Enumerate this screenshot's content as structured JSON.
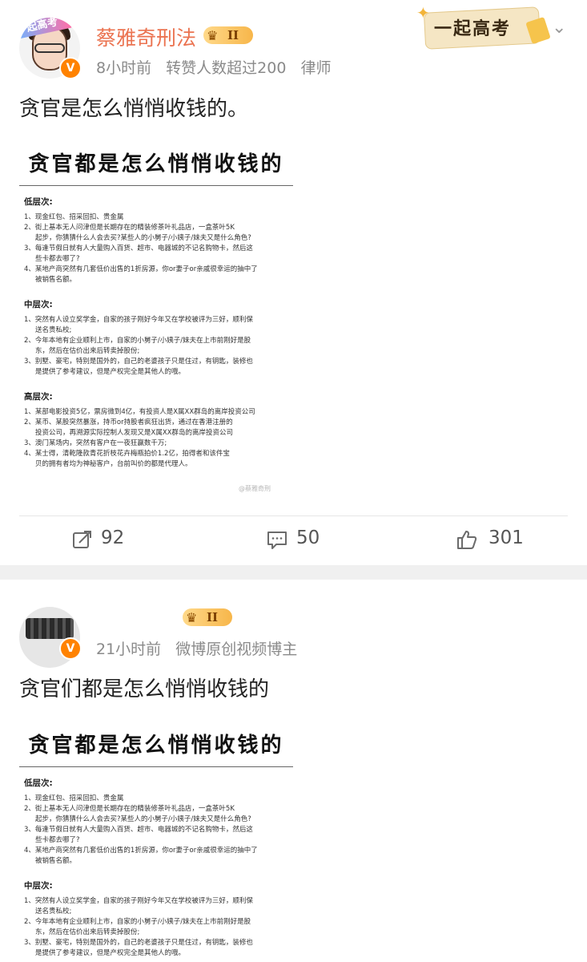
{
  "posts": [
    {
      "username": "蔡雅奇刑法",
      "rank_level": "II",
      "time": "8小时前",
      "reposts_note": "转赞人数超过200",
      "tag": "律师",
      "text": "贪官是怎么悄悄收钱的。",
      "avatar_banner": "起高考",
      "verified_badge": "V",
      "decoration_title": "一起高考",
      "image_watermark": "@蔡雅奇刑",
      "image": {
        "title": "贪官都是怎么悄悄收钱的",
        "sections": [
          {
            "heading": "低层次:",
            "items": [
              [
                "1、现金红包、招采回扣、贵金属"
              ],
              [
                "2、街上基本无人问津但是长期存在的精装修茶叶礼品店，一盒茶叶5K",
                "起步，你猜猜什么人会去买?某些人的小舅子/小姨子/妹夫又是什么角色?"
              ],
              [
                "3、每逢节假日就有人大量购入百货、超市、电器城的不记名购物卡，然后这",
                "些卡都去哪了?"
              ],
              [
                "4、某地产商突然有几套低价出售的1折房源，你or妻子or亲戚很幸运的抽中了",
                "被销售名额。"
              ]
            ]
          },
          {
            "heading": "中层次:",
            "items": [
              [
                "1、突然有人设立奖学金，自家的孩子刚好今年又在学校被评为三好，顺利保",
                "送名贵私校;"
              ],
              [
                "2、今年本地有企业顺利上市，自家的小舅子/小姨子/妹夫在上市前刚好是股",
                "东，然后在估价出来后转卖掉股份;"
              ],
              [
                "3、别墅、豪宅，特别是国外的，自己的老婆孩子只是住过，有钥匙，装修也",
                "是提供了参考建议，但是产权完全是其他人的哦。"
              ]
            ]
          },
          {
            "heading": "高层次:",
            "items": [
              [
                "1、某部电影投资5亿，票房微到4亿，有投资人是X属XX群岛的离岸投资公司"
              ],
              [
                "2、某币、某股突然暴涨，持币or持股者疯狂出货，通过在香港注册的",
                "投资公司，再溯源实际控制人发现又是X属XX群岛的离岸投资公司"
              ],
              [
                "3、澳门某场内，突然有客户在一夜狂赢数千万;"
              ],
              [
                "4、某士得，清乾隆款青花折枝花卉梅瓶拍价1.2亿，拍得者和该件宝",
                "贝的拥有者均为神秘客户，台前叫价的都是代理人。"
              ]
            ]
          }
        ]
      },
      "actions": {
        "reposts": "92",
        "comments": "50",
        "likes": "301"
      }
    },
    {
      "username": "",
      "rank_level": "II",
      "time": "21小时前",
      "tag": "微博原创视频博主",
      "text": "贪官们都是怎么悄悄收钱的",
      "verified_badge": "V",
      "image": {
        "title": "贪官都是怎么悄悄收钱的",
        "sections": [
          {
            "heading": "低层次:",
            "items": [
              [
                "1、现金红包、招采回扣、贵金属"
              ],
              [
                "2、街上基本无人问津但是长期存在的精装修茶叶礼品店，一盒茶叶5K",
                "起步，你猜猜什么人会去买?某些人的小舅子/小姨子/妹夫又是什么角色?"
              ],
              [
                "3、每逢节假日就有人大量购入百货、超市、电器城的不记名购物卡，然后这",
                "些卡都去哪了?"
              ],
              [
                "4、某地产商突然有几套低价出售的1折房源，你or妻子or亲戚很幸运的抽中了",
                "被销售名额。"
              ]
            ]
          },
          {
            "heading": "中层次:",
            "items": [
              [
                "1、突然有人设立奖学金，自家的孩子刚好今年又在学校被评为三好，顺利保",
                "送名贵私校;"
              ],
              [
                "2、今年本地有企业顺利上市，自家的小舅子/小姨子/妹夫在上市前刚好是股",
                "东，然后在估价出来后转卖掉股份;"
              ],
              [
                "3、别墅、豪宅，特别是国外的，自己的老婆孩子只是住过，有钥匙，装修也",
                "是提供了参考建议，但是产权完全是其他人的哦。"
              ]
            ]
          }
        ]
      }
    }
  ],
  "colors": {
    "username": "#eb7350",
    "meta": "#8a8a8a",
    "badge": "#ff8200",
    "separator": "#f0f0f0"
  }
}
